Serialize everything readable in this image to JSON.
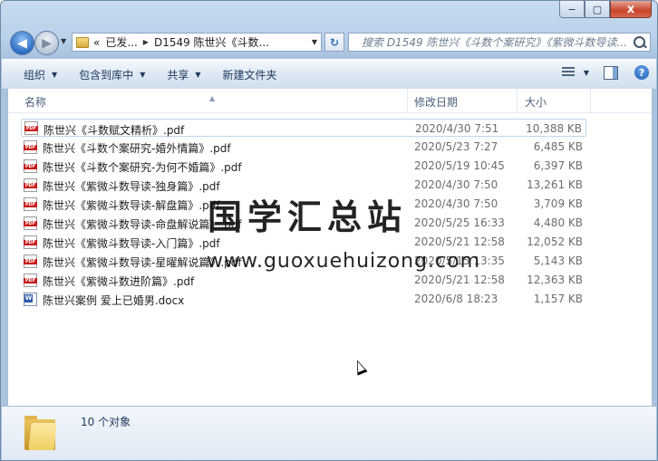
{
  "window": {
    "controls": [
      "−",
      "▢",
      "x"
    ]
  },
  "address": {
    "path": [
      "«",
      "已发...",
      "D1549 陈世兴《斗数..."
    ]
  },
  "search": {
    "placeholder": "搜索 D1549 陈世兴《斗数个案研究》《紫微斗数导读..."
  },
  "toolbar": {
    "organize": "组织",
    "include_library": "包含到库中",
    "share": "共享",
    "new_folder": "新建文件夹",
    "help": "?"
  },
  "columns": {
    "name": "名称",
    "date": "修改日期",
    "size": "大小"
  },
  "files": [
    {
      "name": "陈世兴《斗数赋文精析》.pdf",
      "date": "2020/4/30 7:51",
      "size": "10,388 KB",
      "type": "pdf",
      "selected": true
    },
    {
      "name": "陈世兴《斗数个案研究-婚外情篇》.pdf",
      "date": "2020/5/23 7:27",
      "size": "6,485 KB",
      "type": "pdf"
    },
    {
      "name": "陈世兴《斗数个案研究-为何不婚篇》.pdf",
      "date": "2020/5/19 10:45",
      "size": "6,397 KB",
      "type": "pdf"
    },
    {
      "name": "陈世兴《紫微斗数导读-独身篇》.pdf",
      "date": "2020/4/30 7:50",
      "size": "13,261 KB",
      "type": "pdf"
    },
    {
      "name": "陈世兴《紫微斗数导读-解盘篇》.pdf",
      "date": "2020/4/30 7:50",
      "size": "3,709 KB",
      "type": "pdf"
    },
    {
      "name": "陈世兴《紫微斗数导读-命盘解说篇》.pdf",
      "date": "2020/5/25 16:33",
      "size": "4,480 KB",
      "type": "pdf"
    },
    {
      "name": "陈世兴《紫微斗数导读-入门篇》.pdf",
      "date": "2020/5/21 12:58",
      "size": "12,052 KB",
      "type": "pdf"
    },
    {
      "name": "陈世兴《紫微斗数导读-星曜解说篇》.pdf",
      "date": "2020/5/15 13:35",
      "size": "5,143 KB",
      "type": "pdf"
    },
    {
      "name": "陈世兴《紫微斗数进阶篇》.pdf",
      "date": "2020/5/21 12:58",
      "size": "12,363 KB",
      "type": "pdf"
    },
    {
      "name": "陈世兴案例 爱上已婚男.docx",
      "date": "2020/6/8 18:23",
      "size": "1,157 KB",
      "type": "doc"
    }
  ],
  "watermark": {
    "title": "国学汇总站",
    "url": "www.guoxuehuizong.com"
  },
  "status": {
    "count": "10 个对象"
  }
}
